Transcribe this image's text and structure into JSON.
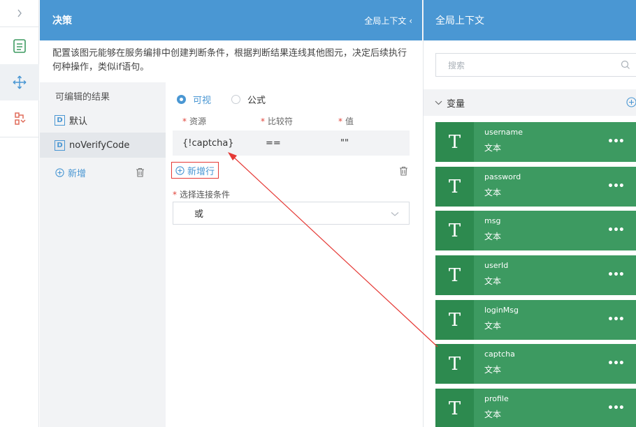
{
  "rail": {
    "icons": [
      "chevron-right-icon",
      "list-doc-icon",
      "move-icon",
      "branch-icon"
    ]
  },
  "decision": {
    "title": "决策",
    "context_toggle": "全局上下文 ‹",
    "description": "配置该图元能够在服务编排中创建判断条件，根据判断结果连线其他图元，决定后续执行何种操作，类似if语句。",
    "results_title": "可编辑的结果",
    "results": [
      {
        "badge": "D",
        "label": "默认"
      },
      {
        "badge": "D",
        "label": "noVerifyCode"
      }
    ],
    "add_label": "新增",
    "mode_options": [
      "可视",
      "公式"
    ],
    "selected_mode": "可视",
    "columns": [
      "资源",
      "比较符",
      "值"
    ],
    "condition_row": {
      "resource": "{!captcha}",
      "operator": "==",
      "value": "\"\""
    },
    "add_row_label": "新增行",
    "connect_label": "选择连接条件",
    "connect_value": "或"
  },
  "context": {
    "title": "全局上下文",
    "search_placeholder": "搜索",
    "section_label": "变量",
    "variables": [
      {
        "name": "username",
        "type": "文本"
      },
      {
        "name": "password",
        "type": "文本"
      },
      {
        "name": "msg",
        "type": "文本"
      },
      {
        "name": "userId",
        "type": "文本"
      },
      {
        "name": "loginMsg",
        "type": "文本"
      },
      {
        "name": "captcha",
        "type": "文本"
      },
      {
        "name": "profile",
        "type": "文本"
      }
    ],
    "type_glyph": "T",
    "more_glyph": "•••"
  },
  "colors": {
    "header_blue": "#4a97d3",
    "card_green": "#3d9a61",
    "annotation_red": "#e53935"
  }
}
